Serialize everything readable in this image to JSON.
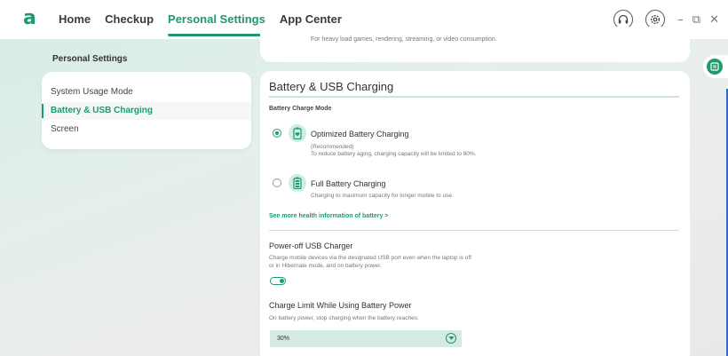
{
  "app": {
    "logo_glyph": "a",
    "accent_color": "#1f9a6a"
  },
  "nav": {
    "items": [
      {
        "label": "Home",
        "active": false
      },
      {
        "label": "Checkup",
        "active": false
      },
      {
        "label": "Personal Settings",
        "active": true
      },
      {
        "label": "App Center",
        "active": false
      }
    ]
  },
  "window_controls": {
    "headset_icon": "headset-icon",
    "settings_icon": "gear-icon",
    "minimize": "–",
    "restore": "⧉",
    "close": "✕"
  },
  "sidebar": {
    "title": "Personal Settings",
    "items": [
      {
        "label": "System Usage Mode",
        "active": false
      },
      {
        "label": "Battery & USB Charging",
        "active": true
      },
      {
        "label": "Screen",
        "active": false
      }
    ]
  },
  "top_card": {
    "description": "For heavy load games, rendering, streaming, or video consumption."
  },
  "battery": {
    "title": "Battery & USB Charging",
    "mode_label": "Battery Charge Mode",
    "options": [
      {
        "title": "Optimized Battery Charging",
        "recommended": "(Recommended)",
        "description": "To reduce battery aging, charging capacity will be limited to 80%.",
        "selected": true
      },
      {
        "title": "Full Battery Charging",
        "description": "Charging to maximum capacity for longer mobile to use.",
        "selected": false
      }
    ],
    "health_link": "See more health information of battery >"
  },
  "usb_charger": {
    "title": "Power-off USB Charger",
    "description_line1": "Charge mobile devices via the designated USB port even when the laptop is off",
    "description_line2": "or in Hibernate mode, and on battery power.",
    "enabled": true
  },
  "charge_limit": {
    "title": "Charge Limit While Using Battery Power",
    "description": "On battery power, stop charging when the battery reaches:",
    "selected_value": "30%"
  }
}
